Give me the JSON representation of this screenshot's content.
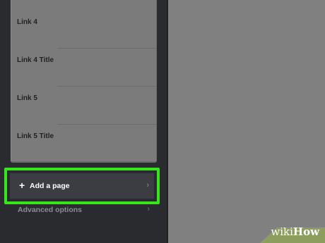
{
  "sidebar": {
    "links": [
      {
        "label": "Link 4"
      },
      {
        "label": "Link 4 Title"
      },
      {
        "label": "Link 5"
      },
      {
        "label": "Link 5 Title"
      }
    ],
    "add_page": {
      "icon": "plus-icon",
      "label": "Add a page",
      "chevron_icon": "chevron-right-icon"
    },
    "advanced_options": {
      "label": "Advanced options",
      "chevron_icon": "chevron-right-icon"
    }
  },
  "colors": {
    "highlight": "#37e51d",
    "sidebar_bg": "#2a2b2e",
    "main_bg": "#808080"
  },
  "watermark": {
    "prefix": "wiki",
    "suffix": "How"
  }
}
